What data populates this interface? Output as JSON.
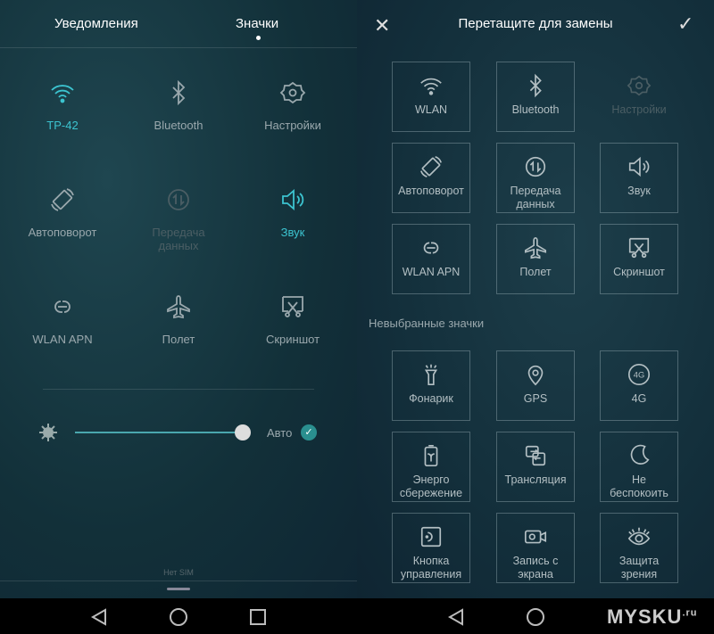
{
  "left": {
    "tabs": [
      {
        "label": "Уведомления",
        "active": false
      },
      {
        "label": "Значки",
        "active": true
      }
    ],
    "toggles": [
      {
        "label": "TP-42",
        "icon": "wifi-icon",
        "state": "active"
      },
      {
        "label": "Bluetooth",
        "icon": "bluetooth-icon",
        "state": "off"
      },
      {
        "label": "Настройки",
        "icon": "gear-icon",
        "state": "off"
      },
      {
        "label": "Автоповорот",
        "icon": "rotate-icon",
        "state": "off"
      },
      {
        "label": "Передача данных",
        "icon": "data-transfer-icon",
        "state": "disabled"
      },
      {
        "label": "Звук",
        "icon": "sound-icon",
        "state": "active"
      },
      {
        "label": "WLAN APN",
        "icon": "link-icon",
        "state": "off"
      },
      {
        "label": "Полет",
        "icon": "airplane-icon",
        "state": "off"
      },
      {
        "label": "Скриншот",
        "icon": "screenshot-icon",
        "state": "off"
      }
    ],
    "brightness": {
      "level_percent": 100,
      "auto_label": "Авто",
      "auto_checked": true
    },
    "sim_status": "Нет SIM"
  },
  "right": {
    "header": {
      "title": "Перетащите для замены",
      "close_icon": "close-icon",
      "confirm_icon": "check-icon"
    },
    "selected": [
      {
        "label": "WLAN",
        "icon": "wifi-icon"
      },
      {
        "label": "Bluetooth",
        "icon": "bluetooth-icon"
      },
      {
        "label": "Настройки",
        "icon": "gear-icon",
        "disabled": true
      },
      {
        "label": "Автоповорот",
        "icon": "rotate-icon"
      },
      {
        "label": "Передача данных",
        "icon": "data-transfer-icon"
      },
      {
        "label": "Звук",
        "icon": "sound-icon"
      },
      {
        "label": "WLAN APN",
        "icon": "link-icon"
      },
      {
        "label": "Полет",
        "icon": "airplane-icon"
      },
      {
        "label": "Скриншот",
        "icon": "screenshot-icon"
      }
    ],
    "unselected_label": "Невыбранные значки",
    "unselected": [
      {
        "label": "Фонарик",
        "icon": "flashlight-icon"
      },
      {
        "label": "GPS",
        "icon": "location-icon"
      },
      {
        "label": "4G",
        "icon": "4g-icon"
      },
      {
        "label": "Энерго сбережение",
        "icon": "battery-icon"
      },
      {
        "label": "Трансляция",
        "icon": "cast-icon"
      },
      {
        "label": "Не беспокоить",
        "icon": "moon-icon"
      },
      {
        "label": "Кнопка управления",
        "icon": "nav-button-icon"
      },
      {
        "label": "Запись с экрана",
        "icon": "screen-record-icon"
      },
      {
        "label": "Защита зрения",
        "icon": "eye-icon"
      }
    ]
  },
  "watermark": "MYSKU.ru",
  "colors": {
    "accent": "#3cc4d0"
  }
}
